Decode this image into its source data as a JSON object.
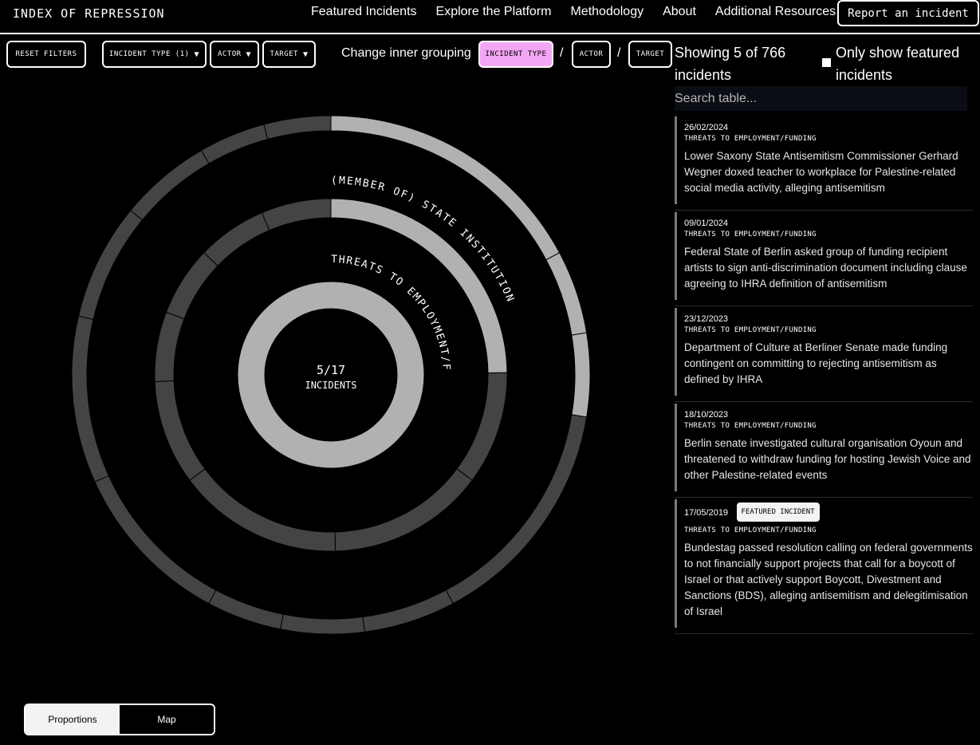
{
  "header": {
    "brand": "INDEX OF REPRESSION",
    "nav": [
      "Featured Incidents",
      "Explore the Platform",
      "Methodology",
      "About",
      "Additional Resources"
    ],
    "report_label": "Report an incident"
  },
  "filters": {
    "reset_label": "RESET FILTERS",
    "incident_type_label": "INCIDENT TYPE (1)",
    "actor_label": "ACTOR",
    "target_label": "TARGET",
    "arrow": "▼",
    "inner_grouping_label": "Change inner grouping",
    "grouping_options": [
      "INCIDENT TYPE",
      "ACTOR",
      "TARGET"
    ],
    "active_grouping": "INCIDENT TYPE",
    "separator": "/"
  },
  "chart_data": {
    "type": "pie",
    "center_value": "5/17",
    "center_label": "INCIDENTS",
    "outer_ring_label": "(MEMBER OF) STATE INSTITUTION",
    "middle_ring_label": "THREATS TO EMPLOYMENT/FUNDING",
    "colors": {
      "highlight": "#b1b1b1",
      "base": "#444444",
      "background": "#000000"
    },
    "rings": [
      {
        "name": "inner",
        "segments": [
          {
            "value": 5,
            "highlighted": true
          }
        ]
      },
      {
        "name": "middle",
        "segments": [
          {
            "value": 3.1,
            "highlighted": true
          },
          {
            "value": 1.3,
            "highlighted": false
          },
          {
            "value": 1.8,
            "highlighted": false
          },
          {
            "value": 1.9,
            "highlighted": false
          },
          {
            "value": 1.2,
            "highlighted": false
          },
          {
            "value": 0.8,
            "highlighted": false
          },
          {
            "value": 0.8,
            "highlighted": false
          },
          {
            "value": 0.8,
            "highlighted": false
          },
          {
            "value": 0.8,
            "highlighted": false
          }
        ]
      },
      {
        "name": "outer",
        "segments": [
          {
            "value": 1.65,
            "highlighted": true
          },
          {
            "value": 0.5,
            "highlighted": true
          },
          {
            "value": 0.5,
            "highlighted": true
          },
          {
            "value": 1.4,
            "highlighted": false
          },
          {
            "value": 0.55,
            "highlighted": false
          },
          {
            "value": 0.5,
            "highlighted": false
          },
          {
            "value": 0.45,
            "highlighted": false
          },
          {
            "value": 1.0,
            "highlighted": false
          },
          {
            "value": 1.0,
            "highlighted": false
          },
          {
            "value": 0.7,
            "highlighted": false
          },
          {
            "value": 0.55,
            "highlighted": false
          },
          {
            "value": 0.4,
            "highlighted": false
          },
          {
            "value": 0.4,
            "highlighted": false
          }
        ]
      }
    ]
  },
  "results": {
    "showing": "Showing 5 of 766 incidents",
    "featured_toggle_label": "Only show featured incidents",
    "search_placeholder": "Search table..."
  },
  "incidents": [
    {
      "date": "26/02/2024",
      "type": "THREATS TO EMPLOYMENT/FUNDING",
      "title": "Lower Saxony State Antisemitism Commissioner Gerhard Wegner doxed teacher to workplace for Palestine-related social media activity, alleging antisemitism",
      "featured": ""
    },
    {
      "date": "09/01/2024",
      "type": "THREATS TO EMPLOYMENT/FUNDING",
      "title": "Federal State of Berlin asked group of funding recipient artists to sign anti-discrimination document including clause agreeing to IHRA definition of antisemitism",
      "featured": ""
    },
    {
      "date": "23/12/2023",
      "type": "THREATS TO EMPLOYMENT/FUNDING",
      "title": "Department of Culture at Berliner Senate made funding contingent on committing to rejecting antisemitism as defined by IHRA",
      "featured": ""
    },
    {
      "date": "18/10/2023",
      "type": "THREATS TO EMPLOYMENT/FUNDING",
      "title": "Berlin senate investigated cultural organisation Oyoun and threatened to withdraw funding for hosting Jewish Voice and other Palestine-related events",
      "featured": ""
    },
    {
      "date": "17/05/2019",
      "type": "THREATS TO EMPLOYMENT/FUNDING",
      "title": "Bundestag passed resolution calling on federal governments to not financially support projects that call for a boycott of Israel or that actively support Boycott, Divestment and Sanctions (BDS), alleging antisemitism and delegitimisation of Israel",
      "featured": "FEATURED INCIDENT"
    }
  ],
  "view_switch": {
    "options": [
      "Proportions",
      "Map"
    ],
    "active": "Proportions"
  }
}
